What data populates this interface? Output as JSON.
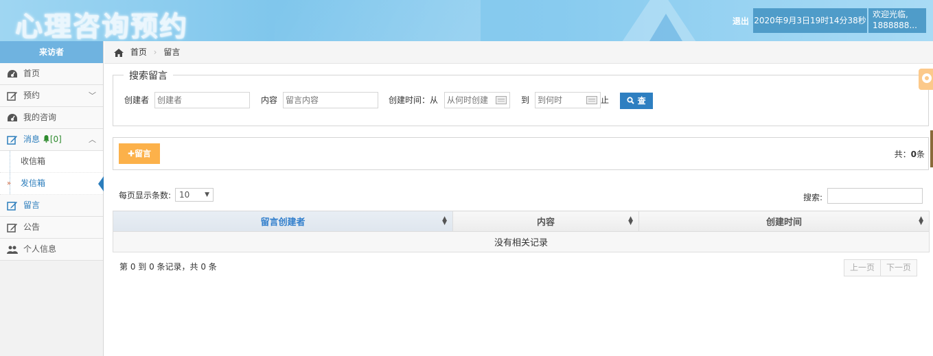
{
  "header": {
    "logo": "心理咨询预约",
    "logout": "退出",
    "datetime": "2020年9月3日19时14分38秒",
    "welcome_line1": "欢迎光临,",
    "welcome_line2": "1888888..."
  },
  "sidebar": {
    "title": "来访者",
    "items": [
      {
        "label": "首页",
        "icon": "dashboard-icon"
      },
      {
        "label": "预约",
        "icon": "edit-icon",
        "chevron": "﹀"
      },
      {
        "label": "我的咨询",
        "icon": "dashboard-icon"
      },
      {
        "label": "消息",
        "badge": "[0]",
        "icon": "edit-icon",
        "chevron": "︿"
      },
      {
        "label": "收信箱"
      },
      {
        "label": "发信箱"
      },
      {
        "label": "留言",
        "icon": "edit-icon"
      },
      {
        "label": "公告",
        "icon": "edit-icon"
      },
      {
        "label": "个人信息",
        "icon": "users-icon"
      }
    ]
  },
  "breadcrumb": {
    "home": "首页",
    "current": "留言"
  },
  "search": {
    "legend": "搜索留言",
    "creator_label": "创建者",
    "creator_placeholder": "创建者",
    "content_label": "内容",
    "content_placeholder": "留言内容",
    "time_label": "创建时间：从",
    "from_placeholder": "从何时创建",
    "to_label": "到",
    "to_placeholder": "到何时",
    "end_label": "止",
    "button": "查"
  },
  "actions": {
    "add_button": "留言",
    "total_prefix": "共：",
    "total_count": "0",
    "total_suffix": "条"
  },
  "table": {
    "page_size_label": "每页显示条数:",
    "page_size": "10",
    "search_label": "搜索:",
    "columns": [
      "留言创建者",
      "内容",
      "创建时间"
    ],
    "empty": "没有相关记录",
    "info": "第 0 到 0 条记录，共 0 条",
    "prev": "上一页",
    "next": "下一页"
  }
}
